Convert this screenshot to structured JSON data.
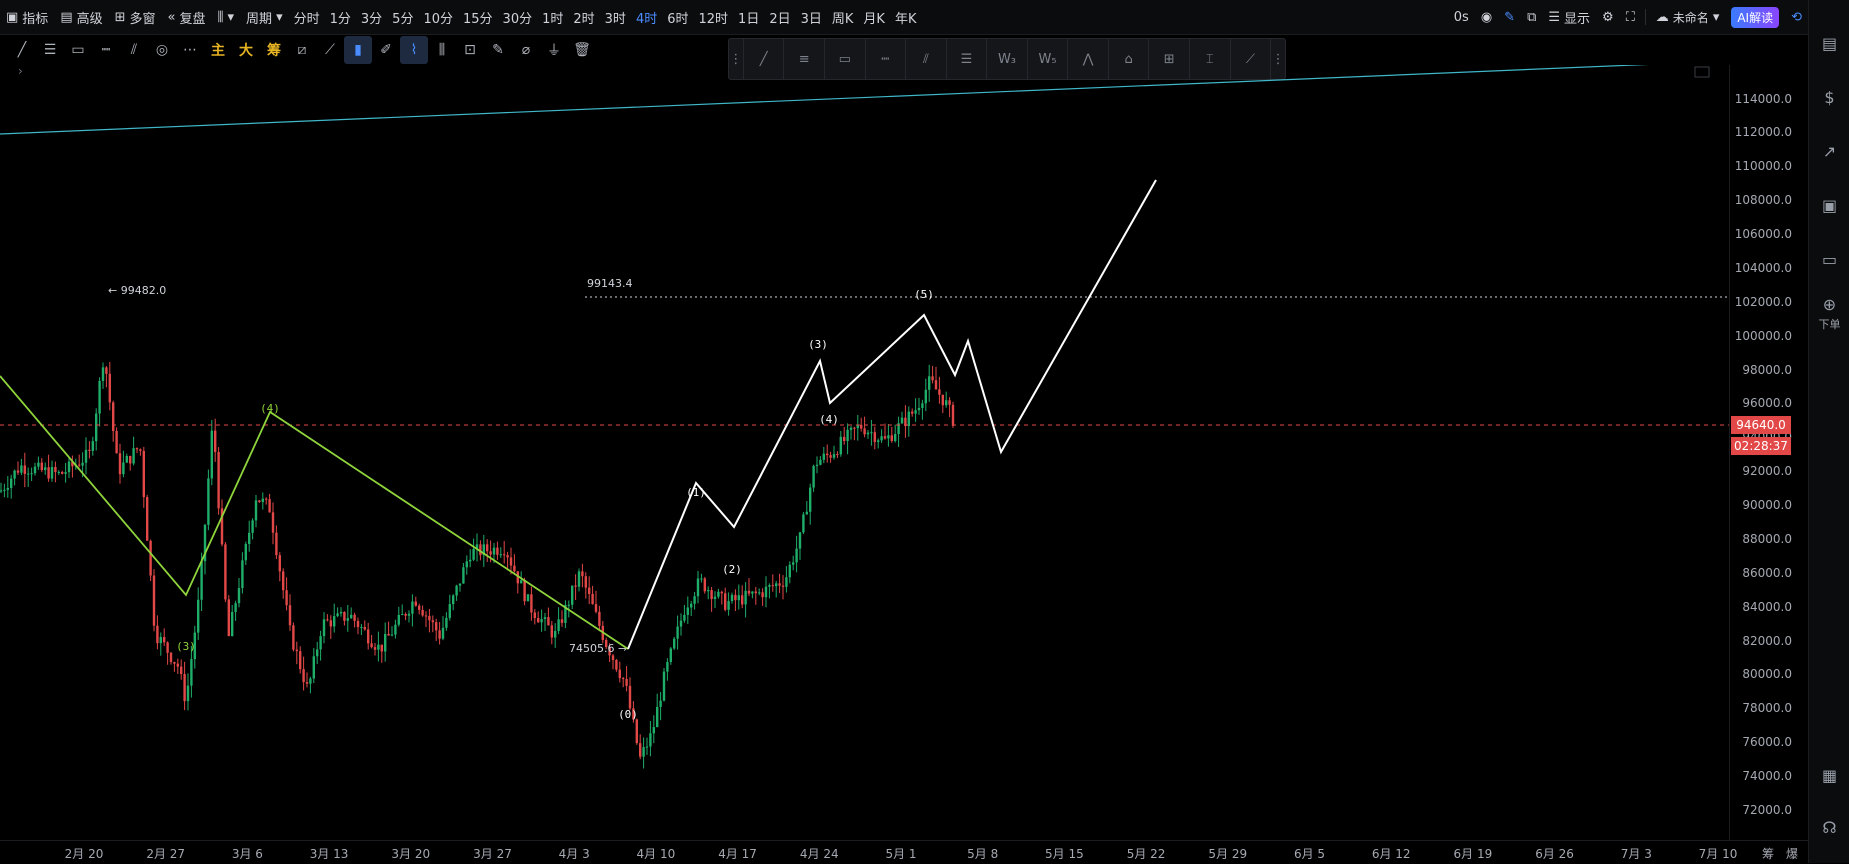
{
  "topbar": {
    "indicators": "指标",
    "advanced": "高级",
    "multi_window": "多窗",
    "replay": "复盘",
    "period": "周期",
    "periods": [
      "分时",
      "1分",
      "3分",
      "5分",
      "10分",
      "15分",
      "30分",
      "1时",
      "2时",
      "3时",
      "4时",
      "6时",
      "12时",
      "1日",
      "2日",
      "3日",
      "周K",
      "月K",
      "年K"
    ],
    "active_period": "4时",
    "timer": "0s",
    "display": "显示",
    "file_name": "未命名",
    "ai_label": "AI解读"
  },
  "toolbar2": {
    "main": "主",
    "big": "大",
    "chips": "筹"
  },
  "right_panel": {
    "order_label": "下单"
  },
  "price_axis": {
    "current_price": "94640.0",
    "countdown": "02:28:37"
  },
  "annotations": {
    "high_label": "← 99482.0",
    "dotted_level": "99143.4",
    "low_label": "74505.6 →"
  },
  "colors": {
    "up": "#1fae6a",
    "down": "#e34848",
    "green_wave": "#8fd43b",
    "white_wave": "#ffffff",
    "trendline": "#3fb7c9",
    "accent": "#4a8cff"
  },
  "chart_data": {
    "type": "candlestick",
    "y_ticks": [
      114000,
      112000,
      110000,
      108000,
      106000,
      104000,
      102000,
      100000,
      98000,
      96000,
      94000,
      92000,
      90000,
      88000,
      86000,
      84000,
      82000,
      80000,
      78000,
      76000,
      74000,
      72000
    ],
    "y_tick_labels": [
      "114000.0",
      "112000.0",
      "110000.0",
      "108000.0",
      "106000.0",
      "104000.0",
      "102000.0",
      "100000.0",
      "98000.0",
      "96000.0",
      "94000.0",
      "92000.0",
      "90000.0",
      "88000.0",
      "86000.0",
      "84000.0",
      "82000.0",
      "80000.0",
      "78000.0",
      "76000.0",
      "74000.0",
      "72000.0"
    ],
    "x_labels": [
      "2月 20",
      "2月 27",
      "3月 6",
      "3月 13",
      "3月 20",
      "3月 27",
      "4月 3",
      "4月 10",
      "4月 17",
      "4月 24",
      "5月 1",
      "5月 8",
      "5月 15",
      "5月 22",
      "5月 29",
      "6月 5",
      "6月 12",
      "6月 19",
      "6月 26",
      "7月 3",
      "7月 10"
    ],
    "x_axis_right_labels": [
      "筹",
      "爆"
    ],
    "current_price": 94640,
    "high": 99482,
    "low": 74505.6,
    "level": 99143.4,
    "green_waves": [
      {
        "label": "(3)",
        "price": 78300
      },
      {
        "label": "(4)",
        "price": 91100
      }
    ],
    "white_waves": [
      {
        "label": "(0)",
        "price": 74500
      },
      {
        "label": "(1)",
        "price": 86100
      },
      {
        "label": "(2)",
        "price": 83100
      },
      {
        "label": "(3)",
        "price": 94700
      },
      {
        "label": "(4)",
        "price": 91700
      },
      {
        "label": "(5)",
        "price": 97900
      }
    ]
  }
}
